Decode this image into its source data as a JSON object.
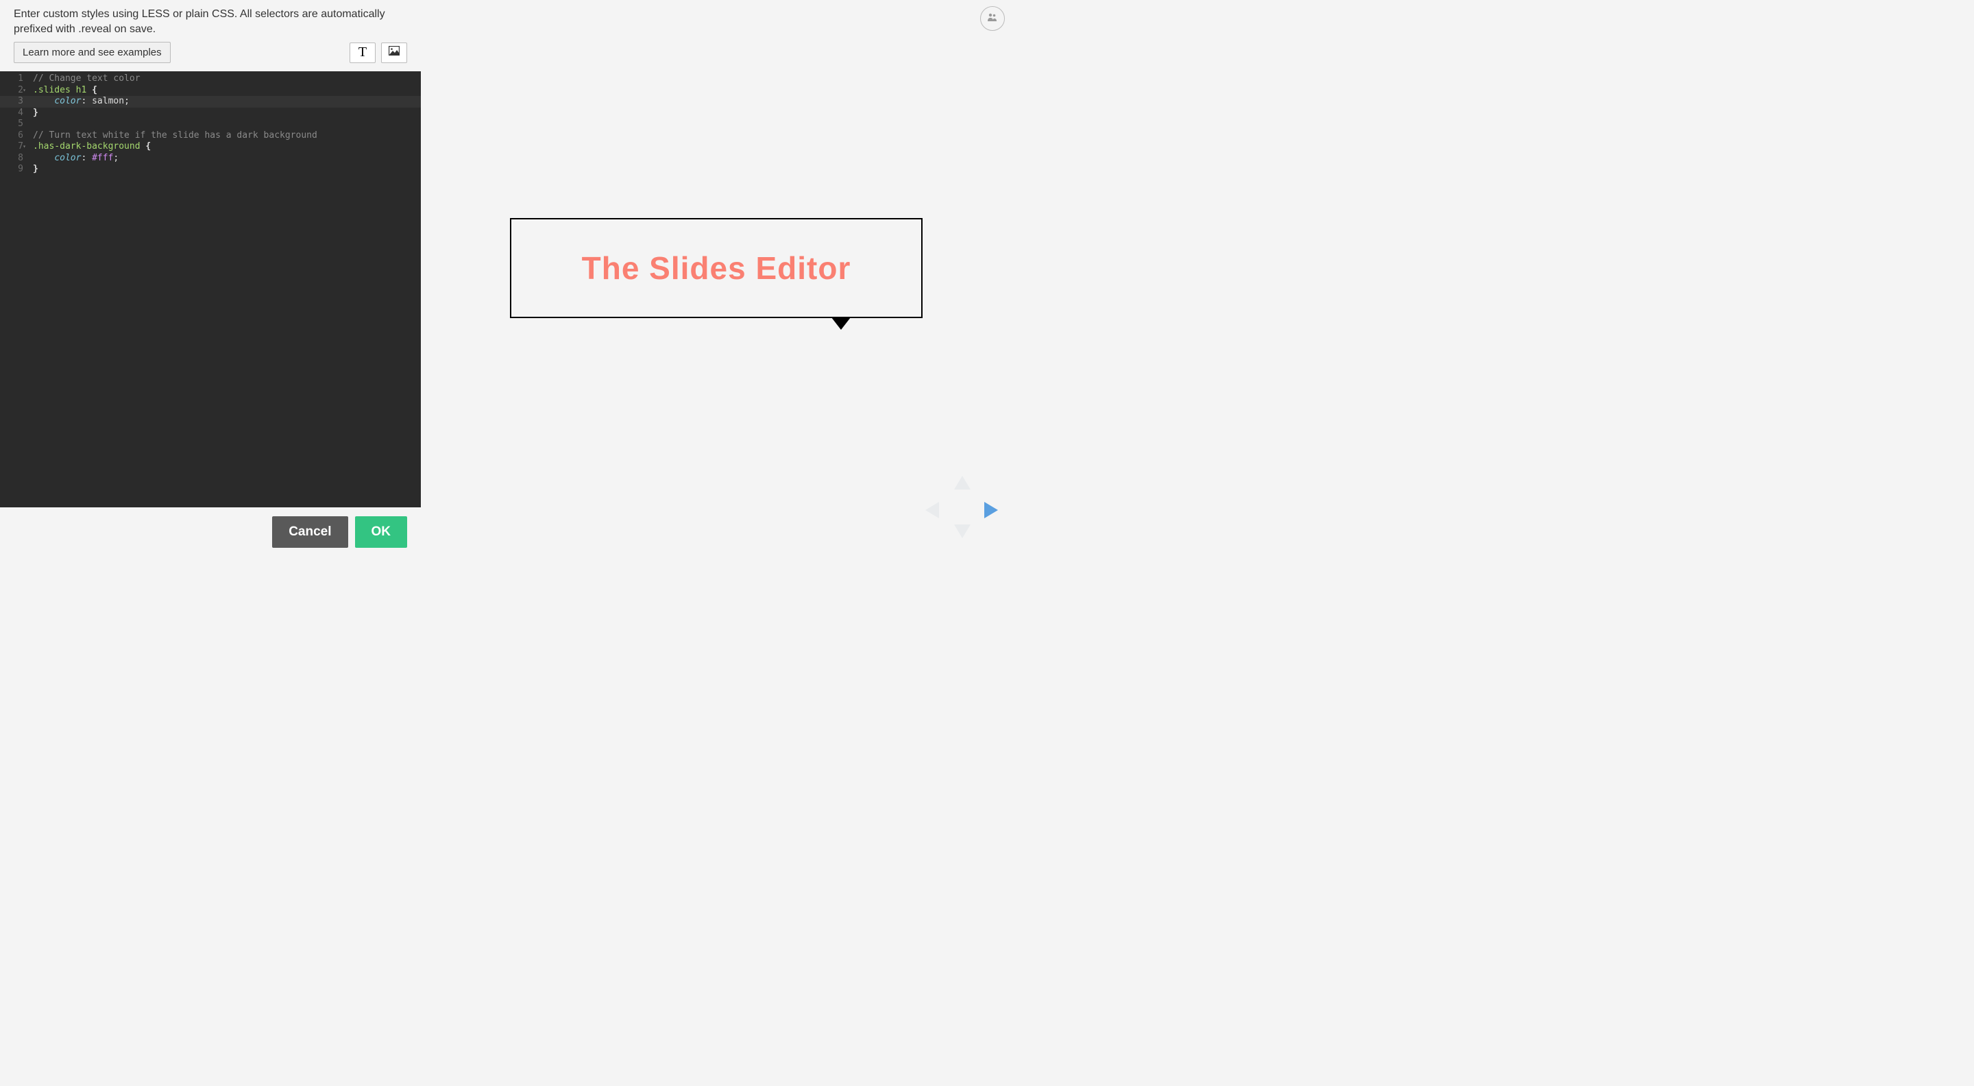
{
  "intro": "Enter custom styles using LESS or plain CSS. All selectors are automatically prefixed with .reveal on save.",
  "learn_more_label": "Learn more and see examples",
  "buttons": {
    "cancel": "Cancel",
    "ok": "OK"
  },
  "code": {
    "l1": {
      "comment": "// Change text color"
    },
    "l2": {
      "selector": ".slides h1",
      "brace": " {"
    },
    "l3": {
      "indent": "    ",
      "prop": "color",
      "colon": ":",
      "value": " salmon",
      "semi": ";"
    },
    "l4": {
      "brace": "}"
    },
    "l5": {
      "text": ""
    },
    "l6": {
      "comment": "// Turn text white if the slide has a dark background"
    },
    "l7": {
      "selector": ".has-dark-background",
      "brace": " {"
    },
    "l8": {
      "indent": "    ",
      "prop": "color",
      "colon": ":",
      "hash": " #fff",
      "semi": ";"
    },
    "l9": {
      "brace": "}"
    }
  },
  "line_numbers": [
    "1",
    "2",
    "3",
    "4",
    "5",
    "6",
    "7",
    "8",
    "9"
  ],
  "preview": {
    "title": "The Slides Editor"
  }
}
